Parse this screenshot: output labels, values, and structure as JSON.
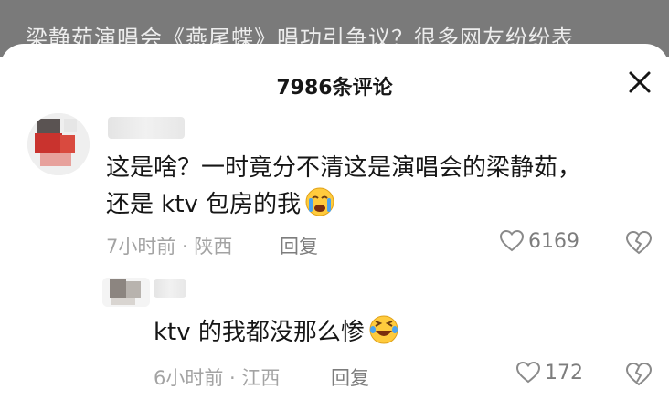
{
  "background": {
    "headline": "梁静茹演唱会《燕尾蝶》唱功引争议？很多网友纷纷表"
  },
  "sheet": {
    "title": "7986条评论"
  },
  "comments": [
    {
      "text_line1": "这是啥？一时竟分不清这是演唱会的梁静茹，",
      "text_line2": "还是 ktv 包房的我",
      "emoji": "crying-face",
      "meta": "7小时前 · 陕西",
      "reply_label": "回复",
      "likes": "6169"
    },
    {
      "text": "ktv 的我都没那么惨",
      "emoji": "laughing-tears-face",
      "meta": "6小时前 · 江西",
      "reply_label": "回复",
      "likes": "172"
    }
  ],
  "colors": {
    "text_primary": "#161616",
    "text_meta": "#a3a3a3",
    "text_action": "#7d7d7d",
    "overlay": "#7a7a7a"
  }
}
